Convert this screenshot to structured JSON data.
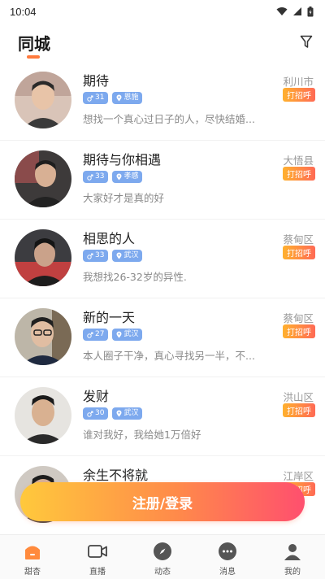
{
  "status_bar": {
    "time": "10:04"
  },
  "header": {
    "title": "同城"
  },
  "colors": {
    "accent": "#ff7a3d",
    "tag_blue": "#7da9ee",
    "greet_start": "#ffb12e",
    "greet_end": "#ff6a55"
  },
  "users": [
    {
      "name": "期待",
      "age": "31",
      "location": "恩施",
      "bio": "想找一个真心过日子的人，尽快结婚...",
      "city": "利川市",
      "greet": "打招呼"
    },
    {
      "name": "期待与你相遇",
      "age": "33",
      "location": "孝感",
      "bio": "大家好才是真的好",
      "city": "大悟县",
      "greet": "打招呼"
    },
    {
      "name": "相思的人",
      "age": "33",
      "location": "武汉",
      "bio": "我想找26-32岁的异性.",
      "city": "蔡甸区",
      "greet": "打招呼"
    },
    {
      "name": "新的一天",
      "age": "27",
      "location": "武汉",
      "bio": "本人圈子干净，真心寻找另一半，不...",
      "city": "蔡甸区",
      "greet": "打招呼"
    },
    {
      "name": "发财",
      "age": "30",
      "location": "武汉",
      "bio": "谁对我好，我给她1万倍好",
      "city": "洪山区",
      "greet": "打招呼"
    },
    {
      "name": "余生不将就",
      "age": "",
      "location": "",
      "bio": "",
      "city": "江岸区",
      "greet": "打招呼"
    }
  ],
  "register_button": {
    "label": "注册/登录"
  },
  "tabbar": [
    {
      "label": "甜杏",
      "icon": "home-icon",
      "active": true
    },
    {
      "label": "直播",
      "icon": "video-camera-icon"
    },
    {
      "label": "动态",
      "icon": "compass-icon"
    },
    {
      "label": "消息",
      "icon": "chat-icon"
    },
    {
      "label": "我的",
      "icon": "person-icon"
    }
  ]
}
